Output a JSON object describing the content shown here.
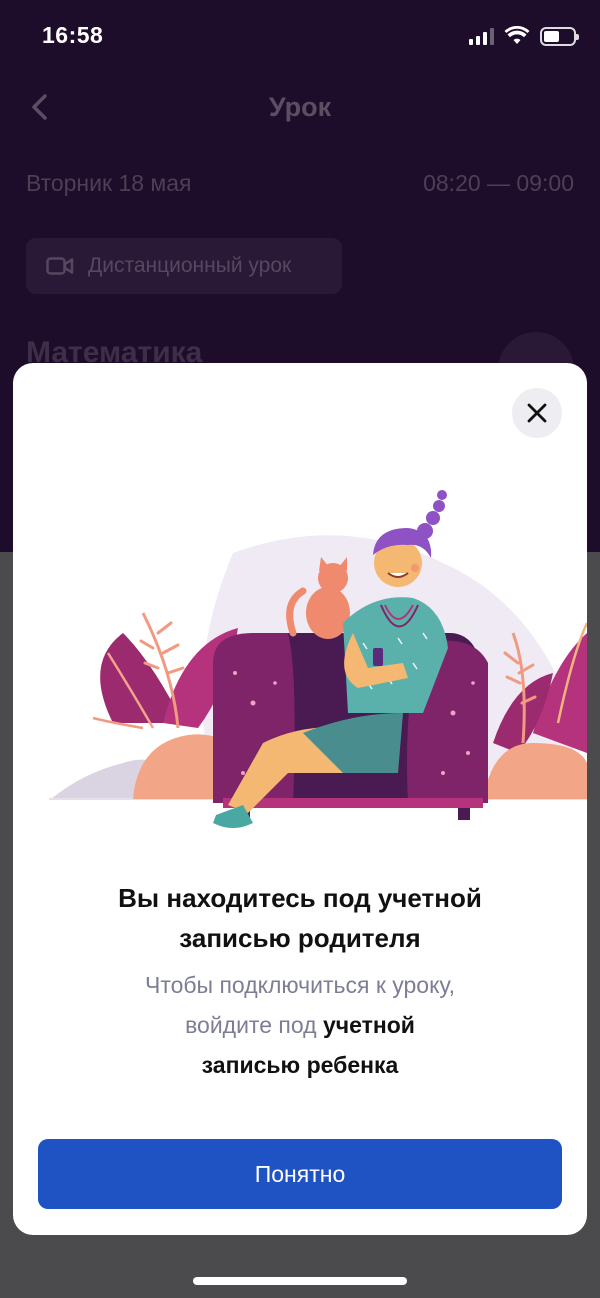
{
  "status_bar": {
    "time": "16:58",
    "signal_icon": "cellular-signal-icon",
    "wifi_icon": "wifi-icon",
    "battery_icon": "battery-icon"
  },
  "nav": {
    "title": "Урок",
    "back_icon": "chevron-left-icon"
  },
  "lesson": {
    "date": "Вторник 18 мая",
    "time": "08:20 — 09:00",
    "format_label": "Дистанционный урок",
    "format_icon": "video-camera-icon",
    "subject": "Математика"
  },
  "modal": {
    "close_icon": "close-icon",
    "title_line1": "Вы находитесь под учетной",
    "title_line2": "записью родителя",
    "text_line1": "Чтобы подключиться к уроку,",
    "text_line2_part1": "войдите под ",
    "text_line2_part2": "учетной",
    "text_line3": "записью ребенка",
    "button_label": "Понятно"
  },
  "colors": {
    "header_bg": "#1e0c2b",
    "primary_button": "#1f53c3",
    "modal_bg": "#ffffff",
    "secondary_text": "#7d7e95"
  }
}
